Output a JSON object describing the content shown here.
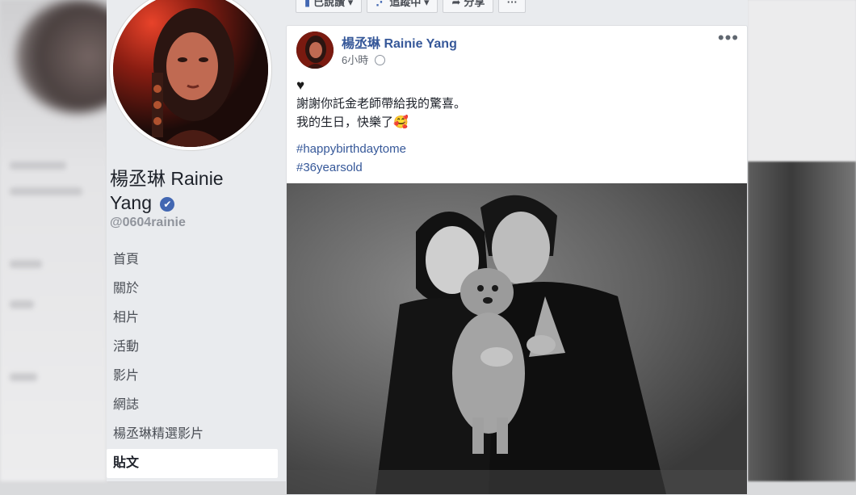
{
  "page": {
    "name_line1": "楊丞琳 Rainie",
    "name_line2": "Yang",
    "handle": "@0604rainie"
  },
  "nav": {
    "items": [
      {
        "label": "首頁"
      },
      {
        "label": "關於"
      },
      {
        "label": "相片"
      },
      {
        "label": "活動"
      },
      {
        "label": "影片"
      },
      {
        "label": "網誌"
      },
      {
        "label": "楊丞琳精選影片"
      },
      {
        "label": "貼文",
        "active": true
      }
    ]
  },
  "actions": {
    "liked": "已說讚",
    "following": "追蹤中",
    "share": "分享",
    "more": "···"
  },
  "post": {
    "author": "楊丞琳 Rainie Yang",
    "time": "6小時",
    "menu": "•••",
    "line1": "謝謝你託金老師帶給我的驚喜。",
    "line2": "我的生日，快樂了🥰",
    "hashtag1": "#happybirthdaytome",
    "hashtag2": "#36yearsold"
  },
  "colors": {
    "link": "#365899",
    "sidebar_bg": "#e9ebee",
    "verified": "#4267b2"
  },
  "icons": [
    "verified-icon",
    "globe-icon",
    "black-heart-icon",
    "like-icon",
    "rss-icon",
    "share-icon"
  ]
}
